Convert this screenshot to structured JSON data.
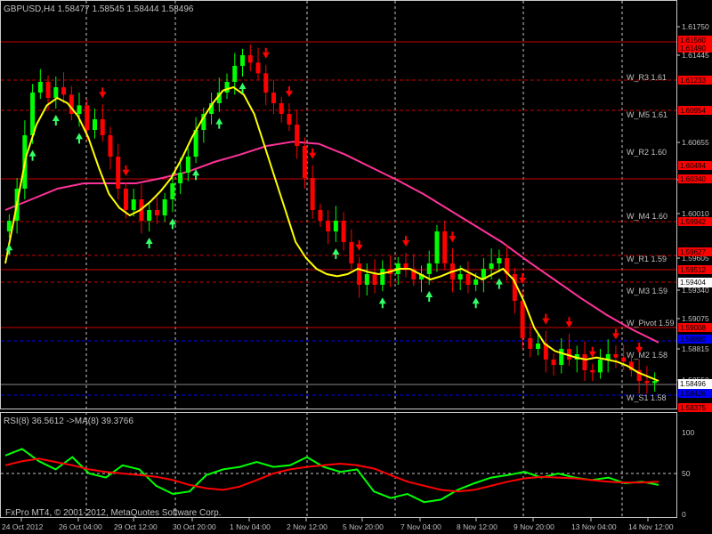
{
  "colors": {
    "background": "#000000",
    "grid": "#c8c8c8",
    "bull": "#00ff00",
    "bear": "#ff0000",
    "up_arrow": "#33ff66",
    "down_arrow": "#ff0000",
    "ma_fast": "#ffff00",
    "ma_slow": "#ff3399",
    "pivot_line": "#cc0000",
    "rsi": "#00ff00",
    "rsi_ma": "#ff0000",
    "label_text": "#c0c0c0",
    "current_price_bg": "#ffffff",
    "blue_tag": "#0000ff",
    "red_tag": "#ff0000"
  },
  "main_header": "GBPUSD,H4  1.58477 1.58545 1.58444 1.58496",
  "sub_header": "RSI(8) 36.5612   ->MA(8) 39.3766",
  "footer": "FxPro MT4, © 2001-2012, MetaQuotes Software Corp.",
  "price_axis_labels": [
    "1.61750",
    "1.61445",
    "1.60655",
    "1.60340",
    "1.60010",
    "1.59605",
    "1.59340",
    "1.59075",
    "1.58815",
    "1.58550"
  ],
  "current_price": "1.58496",
  "pivot_price": "1.59404",
  "red_tags": [
    "1.61560",
    "1.61490",
    "1.61233",
    "1.60954",
    "1.60494",
    "1.60340",
    "1.59942",
    "1.59627",
    "1.59512",
    "1.59008",
    "1.58375"
  ],
  "blue_tags": [
    "1.58880",
    "1.58426"
  ],
  "rsi_axis_labels": [
    "100",
    "50",
    "0"
  ],
  "time_labels": [
    "24 Oct 2012",
    "26 Oct 04:00",
    "29 Oct 12:00",
    "30 Oct 20:00",
    "1 Nov 04:00",
    "2 Nov 12:00",
    "5 Nov 20:00",
    "7 Nov 04:00",
    "8 Nov 12:00",
    "9 Nov 20:00",
    "13 Nov 04:00",
    "14 Nov 12:00"
  ],
  "pivot_levels": [
    {
      "name": "W_R3 1.61",
      "price": 1.613
    },
    {
      "name": "W_M5 1.61",
      "price": 1.6095
    },
    {
      "name": "W_R2 1.60",
      "price": 1.606
    },
    {
      "name": "W_M4 1.60",
      "price": 1.6
    },
    {
      "name": "W_R1 1.59",
      "price": 1.596
    },
    {
      "name": "W_M3 1.59",
      "price": 1.593
    },
    {
      "name": "W_Pivot 1.59",
      "price": 1.59
    },
    {
      "name": "W_M2 1.58",
      "price": 1.587
    },
    {
      "name": "W_S1 1.58",
      "price": 1.583
    }
  ],
  "chart_data": {
    "type": "candlestick",
    "symbol": "GBPUSD",
    "timeframe": "H4",
    "ylim": [
      1.583,
      1.619
    ],
    "closes": [
      1.6,
      1.603,
      1.608,
      1.612,
      1.613,
      1.6115,
      1.6125,
      1.6118,
      1.61,
      1.6108,
      1.6085,
      1.6095,
      1.608,
      1.606,
      1.603,
      1.601,
      1.602,
      1.6,
      1.601,
      1.6005,
      1.602,
      1.6035,
      1.6045,
      1.606,
      1.6085,
      1.61,
      1.611,
      1.612,
      1.613,
      1.6145,
      1.6155,
      1.6148,
      1.6138,
      1.612,
      1.611,
      1.61,
      1.609,
      1.607,
      1.604,
      1.601,
      1.6,
      1.599,
      1.6,
      1.598,
      1.596,
      1.594,
      1.595,
      1.594,
      1.5955,
      1.595,
      1.596,
      1.5955,
      1.5945,
      1.595,
      1.596,
      1.599,
      1.596,
      1.5945,
      1.595,
      1.594,
      1.5945,
      1.5955,
      1.596,
      1.5965,
      1.595,
      1.5925,
      1.589,
      1.588,
      1.5885,
      1.587,
      1.5865,
      1.588,
      1.587,
      1.5875,
      1.586,
      1.5858,
      1.587,
      1.5875,
      1.5872,
      1.5868,
      1.586,
      1.585,
      1.5848,
      1.585
    ],
    "ma_fast": [
      1.596,
      1.601,
      1.606,
      1.609,
      1.6108,
      1.6115,
      1.611,
      1.6098,
      1.6078,
      1.605,
      1.6025,
      1.6012,
      1.6005,
      1.601,
      1.6018,
      1.6028,
      1.604,
      1.6058,
      1.6078,
      1.6095,
      1.611,
      1.6122,
      1.6125,
      1.6118,
      1.61,
      1.607,
      1.604,
      1.601,
      1.598,
      1.5965,
      1.5955,
      1.595,
      1.5948,
      1.595,
      1.5955,
      1.5952,
      1.595,
      1.5952,
      1.5955,
      1.5955,
      1.595,
      1.5945,
      1.5948,
      1.5952,
      1.5955,
      1.595,
      1.5945,
      1.595,
      1.5955,
      1.5945,
      1.5925,
      1.59,
      1.5885,
      1.5878,
      1.5875,
      1.5872,
      1.587,
      1.5872,
      1.587,
      1.5868,
      1.5864,
      1.5858,
      1.5854,
      1.585
    ],
    "ma_slow": [
      1.601,
      1.602,
      1.603,
      1.6035,
      1.6035,
      1.6035,
      1.604,
      1.6046,
      1.6055,
      1.6062,
      1.607,
      1.6074,
      1.6072,
      1.6062,
      1.605,
      1.6038,
      1.6025,
      1.601,
      1.5995,
      1.598,
      1.5962,
      1.5945,
      1.5928,
      1.5912,
      1.5898,
      1.5886
    ],
    "rsi_ylim": [
      0,
      100
    ],
    "rsi": [
      72,
      80,
      65,
      55,
      70,
      50,
      45,
      60,
      55,
      35,
      25,
      28,
      48,
      55,
      58,
      64,
      58,
      60,
      70,
      58,
      52,
      55,
      28,
      20,
      25,
      15,
      18,
      30,
      38,
      45,
      48,
      52,
      45,
      50,
      45,
      42,
      45,
      38,
      40,
      36
    ],
    "rsi_ma": [
      60,
      65,
      68,
      64,
      60,
      55,
      52,
      50,
      48,
      46,
      42,
      36,
      32,
      30,
      34,
      42,
      50,
      55,
      58,
      60,
      62,
      60,
      56,
      48,
      40,
      35,
      30,
      28,
      30,
      35,
      40,
      44,
      46,
      45,
      44,
      42,
      40,
      39,
      39,
      40
    ]
  }
}
